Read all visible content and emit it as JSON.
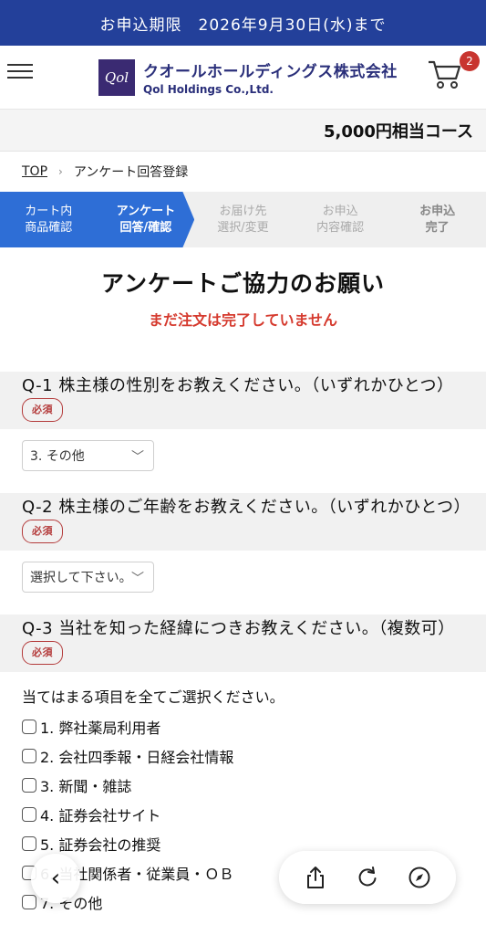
{
  "banner": {
    "text": "お申込期限　2026年9月30日(水)まで"
  },
  "header": {
    "logo_mark": "Qol",
    "company_jp": "クオールホールディングス株式会社",
    "company_en": "Qol Holdings Co.,Ltd.",
    "cart_count": "2"
  },
  "course": {
    "label": "5,000円相当コース"
  },
  "breadcrumb": {
    "top": "TOP",
    "sep": "›",
    "current": "アンケート回答登録"
  },
  "steps": [
    {
      "line1": "カート内",
      "line2": "商品確認"
    },
    {
      "line1": "アンケート",
      "line2": "回答/確認"
    },
    {
      "line1": "お届け先",
      "line2": "選択/変更"
    },
    {
      "line1": "お申込",
      "line2": "内容確認"
    },
    {
      "line1": "お申込",
      "line2": "完了"
    }
  ],
  "title": "アンケートご協力のお願い",
  "notice": "まだ注文は完了していません",
  "required_label": "必須",
  "questions": [
    {
      "text": "Q-1 株主様の性別をお教えください。（いずれかひとつ）",
      "select_value": "3. その他"
    },
    {
      "text": "Q-2 株主様のご年齢をお教えください。（いずれかひとつ）",
      "select_value": "選択して下さい。"
    },
    {
      "text": "Q-3 当社を知った経緯につきお教えください。（複数可）"
    }
  ],
  "q3": {
    "instruction": "当てはまる項目を全てご選択ください。",
    "options": [
      "1. 弊社薬局利用者",
      "2. 会社四季報・日経会社情報",
      "3. 新聞・雑誌",
      "4. 証券会社サイト",
      "5. 証券会社の推奨",
      "6. 当社関係者・従業員・ＯＢ",
      "7. その他"
    ]
  },
  "browser": {
    "back_icon": "chevron-left-icon",
    "share_icon": "share-icon",
    "reload_icon": "reload-icon",
    "compass_icon": "compass-icon"
  }
}
